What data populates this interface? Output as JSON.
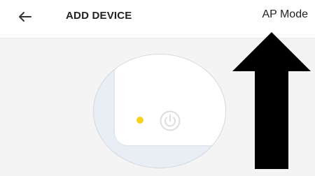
{
  "header": {
    "back_icon": "arrow-left-icon",
    "title": "ADD DEVICE",
    "ap_mode_label": "AP Mode"
  },
  "device": {
    "led_color": "#f7d31f",
    "power_icon": "power-icon"
  },
  "colors": {
    "header_bg": "#ffffff",
    "page_bg": "#f4f4f4",
    "circle_bg": "#e9eef5",
    "arrow": "#000000"
  }
}
